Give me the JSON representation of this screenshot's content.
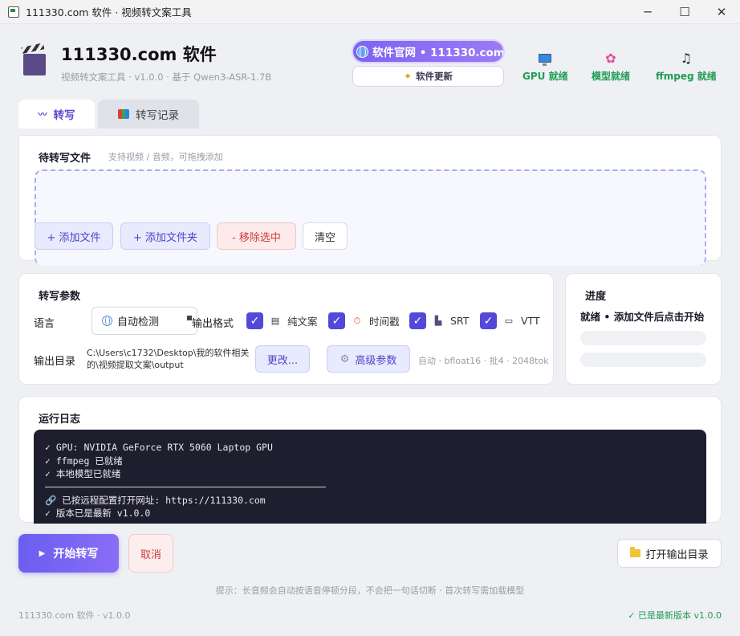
{
  "window": {
    "title": "111330.com 软件 · 视频转文案工具",
    "controls": {
      "minimize": "─",
      "maximize": "☐",
      "close": "✕"
    }
  },
  "header": {
    "app_name": "111330.com 软件",
    "subtitle": "视频转文案工具 · v1.0.0 · 基于 Qwen3-ASR-1.7B",
    "site_button": "软件官网 • 111330.com",
    "update_button": "软件更新",
    "statuses": [
      {
        "label": "GPU 就绪",
        "icon": "monitor-icon"
      },
      {
        "label": "模型就绪",
        "icon": "brain-icon"
      },
      {
        "label": "ffmpeg 就绪",
        "icon": "music-note-icon"
      }
    ],
    "status_color": "#1f9d52"
  },
  "tabs": [
    {
      "label": "转写",
      "icon": "waveform-icon",
      "active": true
    },
    {
      "label": "转写记录",
      "icon": "record-icon",
      "active": false
    }
  ],
  "files": {
    "title": "待转写文件",
    "hint": "支持视频 / 音频，可拖拽添加",
    "buttons": {
      "add_file": "+  添加文件",
      "add_folder": "+  添加文件夹",
      "remove": "-  移除选中",
      "clear": "清空"
    }
  },
  "params": {
    "title": "转写参数",
    "language_label": "语言",
    "language_value": "自动检测",
    "format_label": "输出格式",
    "formats": [
      {
        "label": "纯文案",
        "checked": true,
        "icon": "document-icon"
      },
      {
        "label": "时间戳",
        "checked": true,
        "icon": "stopwatch-icon"
      },
      {
        "label": "SRT",
        "checked": true,
        "icon": "clapper-icon"
      },
      {
        "label": "VTT",
        "checked": true,
        "icon": "caption-icon"
      }
    ],
    "outdir_label": "输出目录",
    "outdir_value": "C:\\Users\\c1732\\Desktop\\我的软件相关的\\视频提取文案\\output",
    "change_button": "更改...",
    "advanced_button": "高级参数",
    "info": "自动 · bfloat16 · 批4 · 2048tok"
  },
  "progress": {
    "title": "进度",
    "status": "就绪 • 添加文件后点击开始"
  },
  "log": {
    "title": "运行日志",
    "lines_top": [
      "✓ GPU: NVIDIA GeForce RTX 5060 Laptop GPU",
      "✓ ffmpeg 已就绪",
      "✓ 本地模型已就绪"
    ],
    "lines_bottom": [
      "🔗 已按远程配置打开网址: https://111330.com",
      "✓ 版本已是最新 v1.0.0"
    ]
  },
  "actions": {
    "start": "开始转写",
    "cancel": "取消",
    "open_output": "打开输出目录"
  },
  "tip": "提示：长音频会自动按语音停顿分段，不会把一句话切断 · 首次转写需加载模型",
  "footer": {
    "left": "111330.com 软件 · v1.0.0",
    "right": "✓ 已是最新版本 v1.0.0"
  },
  "colors": {
    "accent": "#5548d9",
    "danger": "#d03c3c",
    "success": "#1f9d52"
  }
}
